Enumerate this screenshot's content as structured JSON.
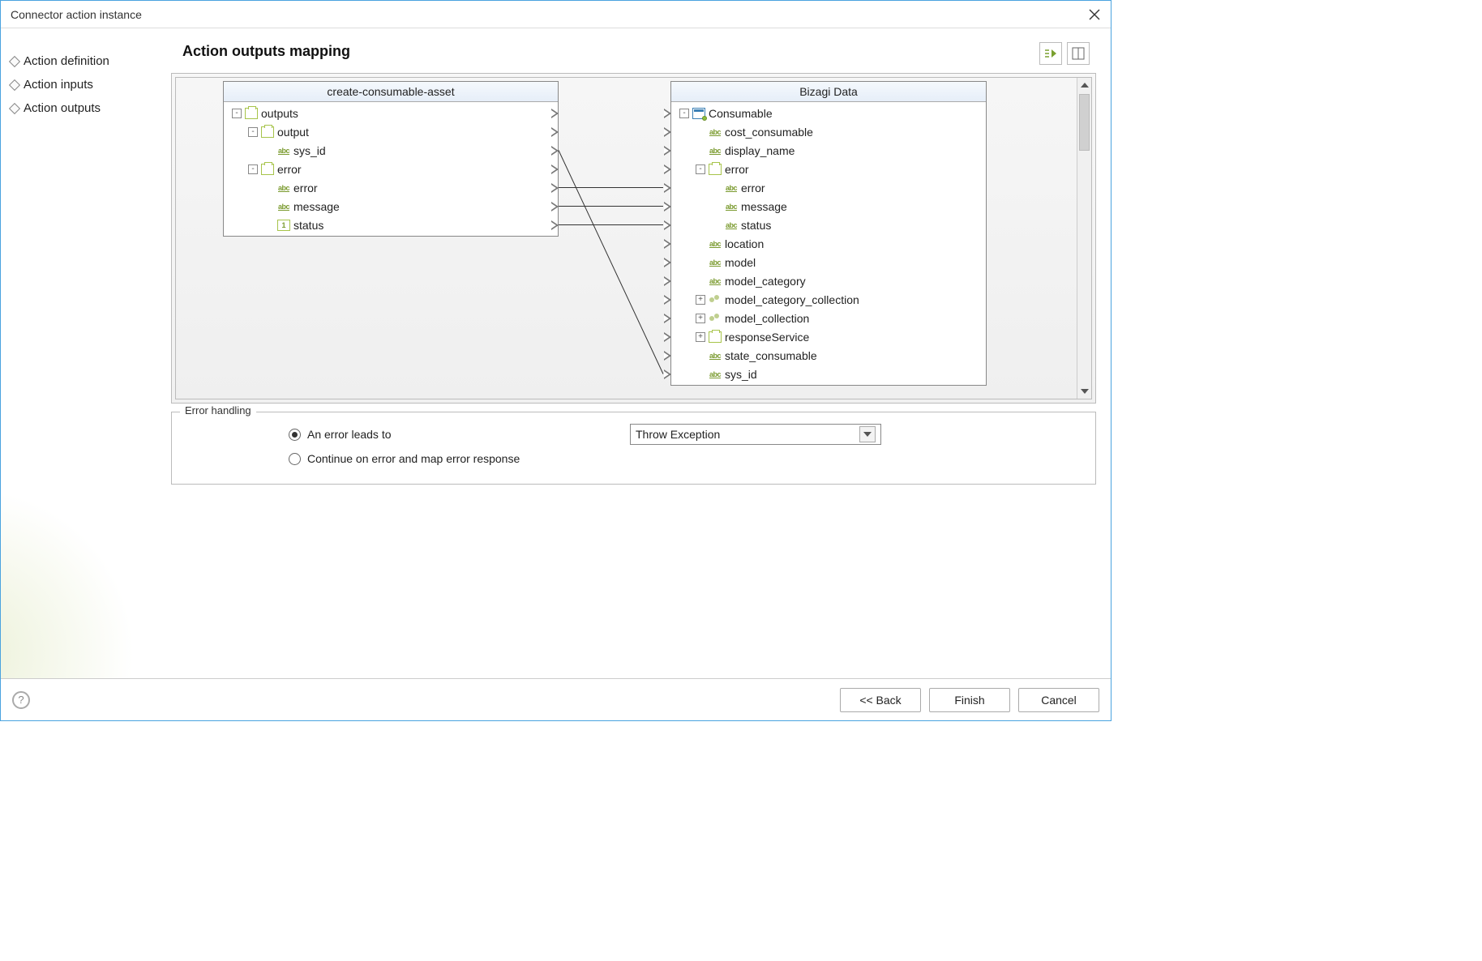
{
  "window": {
    "title": "Connector action instance"
  },
  "sidebar": {
    "items": [
      {
        "label": "Action definition"
      },
      {
        "label": "Action inputs"
      },
      {
        "label": "Action outputs"
      }
    ]
  },
  "page": {
    "title": "Action outputs mapping"
  },
  "source_tree": {
    "header": "create-consumable-asset",
    "nodes": [
      {
        "indent": 0,
        "toggle": "-",
        "icon": "obj",
        "label": "outputs",
        "port": true
      },
      {
        "indent": 1,
        "toggle": "-",
        "icon": "obj",
        "label": "output",
        "port": true
      },
      {
        "indent": 2,
        "toggle": "",
        "icon": "abc",
        "label": "sys_id",
        "port": true
      },
      {
        "indent": 1,
        "toggle": "-",
        "icon": "obj",
        "label": "error",
        "port": true
      },
      {
        "indent": 2,
        "toggle": "",
        "icon": "abc",
        "label": "error",
        "port": true
      },
      {
        "indent": 2,
        "toggle": "",
        "icon": "abc",
        "label": "message",
        "port": true
      },
      {
        "indent": 2,
        "toggle": "",
        "icon": "num",
        "label": "status",
        "port": true
      }
    ]
  },
  "target_tree": {
    "header": "Bizagi Data",
    "nodes": [
      {
        "indent": 0,
        "toggle": "-",
        "icon": "ent",
        "label": "Consumable",
        "port": true
      },
      {
        "indent": 1,
        "toggle": "",
        "icon": "abc",
        "label": "cost_consumable",
        "port": true
      },
      {
        "indent": 1,
        "toggle": "",
        "icon": "abc",
        "label": "display_name",
        "port": true
      },
      {
        "indent": 1,
        "toggle": "-",
        "icon": "obj",
        "label": "error",
        "port": true
      },
      {
        "indent": 2,
        "toggle": "",
        "icon": "abc",
        "label": "error",
        "port": true
      },
      {
        "indent": 2,
        "toggle": "",
        "icon": "abc",
        "label": "message",
        "port": true
      },
      {
        "indent": 2,
        "toggle": "",
        "icon": "abc",
        "label": "status",
        "port": true
      },
      {
        "indent": 1,
        "toggle": "",
        "icon": "abc",
        "label": "location",
        "port": true
      },
      {
        "indent": 1,
        "toggle": "",
        "icon": "abc",
        "label": "model",
        "port": true
      },
      {
        "indent": 1,
        "toggle": "",
        "icon": "abc",
        "label": "model_category",
        "port": true
      },
      {
        "indent": 1,
        "toggle": "+",
        "icon": "coll",
        "label": "model_category_collection",
        "port": true
      },
      {
        "indent": 1,
        "toggle": "+",
        "icon": "coll",
        "label": "model_collection",
        "port": true
      },
      {
        "indent": 1,
        "toggle": "+",
        "icon": "obj",
        "label": "responseService",
        "port": true
      },
      {
        "indent": 1,
        "toggle": "",
        "icon": "abc",
        "label": "state_consumable",
        "port": true
      },
      {
        "indent": 1,
        "toggle": "",
        "icon": "abc",
        "label": "sys_id",
        "port": true
      }
    ]
  },
  "mappings": [
    {
      "from": "sys_id",
      "to": "sys_id"
    },
    {
      "from": "error",
      "to": "error"
    },
    {
      "from": "message",
      "to": "message"
    },
    {
      "from": "status",
      "to": "status"
    }
  ],
  "error_handling": {
    "legend": "Error handling",
    "option_a": "An error leads to",
    "option_b": "Continue on error and map error response",
    "selected": "a",
    "dropdown_value": "Throw Exception"
  },
  "footer": {
    "back": "<< Back",
    "finish": "Finish",
    "cancel": "Cancel"
  },
  "icons": {
    "abc_text": "abc",
    "num_text": "1"
  }
}
